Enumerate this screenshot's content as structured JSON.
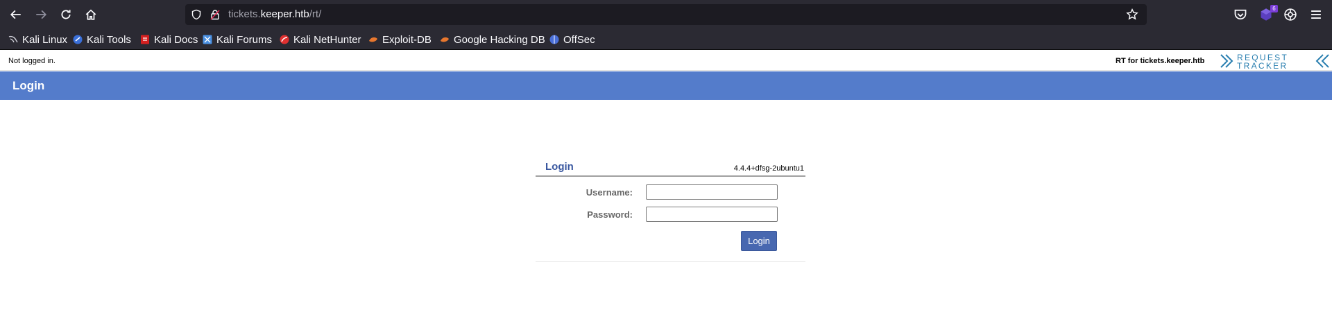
{
  "browser": {
    "url_host_prefix": "tickets.",
    "url_host_main": "keeper.htb",
    "url_path": "/rt/",
    "extension_badge": "6",
    "bookmarks": [
      {
        "label": "Kali Linux",
        "icon": "kali-linux-icon",
        "color": "#111111"
      },
      {
        "label": "Kali Tools",
        "icon": "kali-tools-icon",
        "color": "#3a6fd8"
      },
      {
        "label": "Kali Docs",
        "icon": "kali-docs-icon",
        "color": "#d42020"
      },
      {
        "label": "Kali Forums",
        "icon": "kali-forums-icon",
        "color": "#4a90e2"
      },
      {
        "label": "Kali NetHunter",
        "icon": "kali-nethunter-icon",
        "color": "#e03030"
      },
      {
        "label": "Exploit-DB",
        "icon": "exploit-db-icon",
        "color": "#e8772e"
      },
      {
        "label": "Google Hacking DB",
        "icon": "google-hacking-db-icon",
        "color": "#e8772e"
      },
      {
        "label": "OffSec",
        "icon": "offsec-icon",
        "color": "#4a6fd8"
      }
    ]
  },
  "rt": {
    "status": "Not logged in.",
    "rt_for": "RT for tickets.keeper.htb",
    "logo_line1": "REQUEST",
    "logo_line2": "TRACKER",
    "page_title": "Login",
    "box_title": "Login",
    "version": "4.4.4+dfsg-2ubuntu1",
    "username_label": "Username:",
    "password_label": "Password:",
    "username_value": "",
    "password_value": "",
    "login_button": "Login",
    "colors": {
      "title_bar": "#547ccb",
      "button": "#4868b0",
      "logo": "#2a7fb0"
    }
  }
}
